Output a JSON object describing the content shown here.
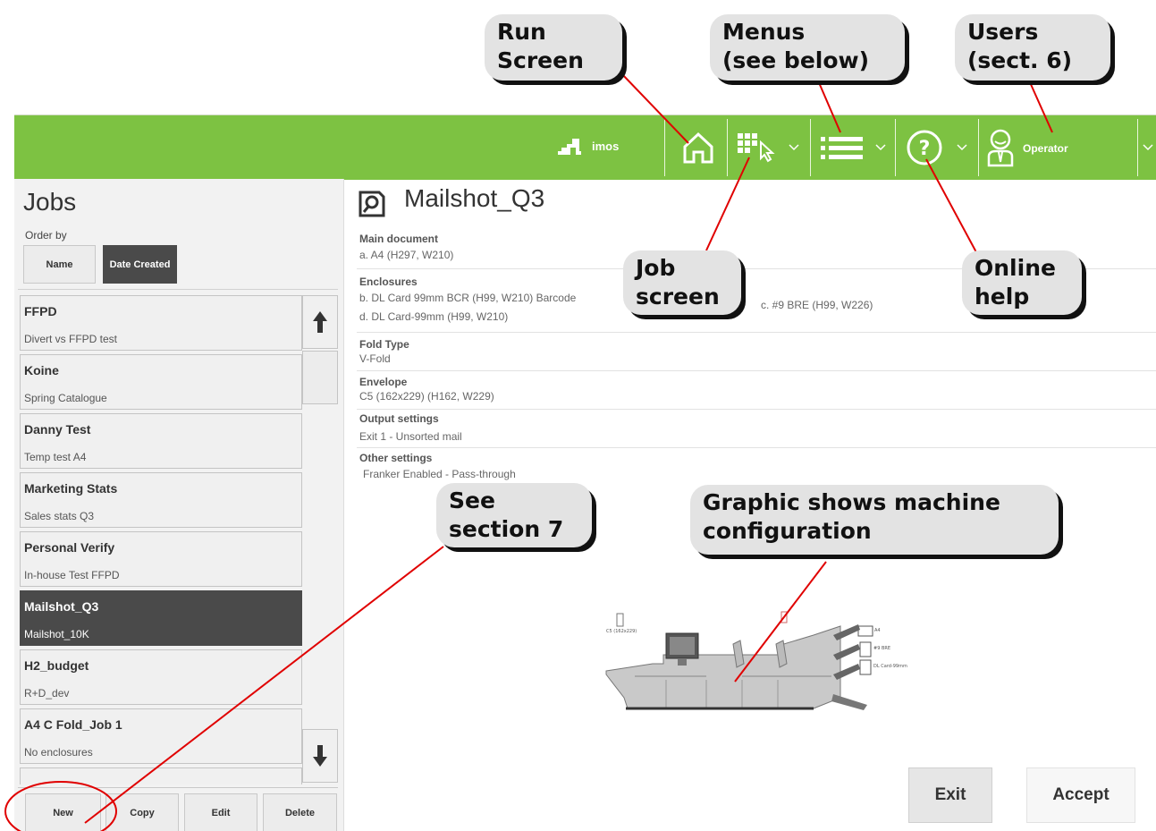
{
  "topbar": {
    "brand_name": "imos",
    "user_label": "Operator",
    "icons": [
      "franker-icon",
      "home-icon",
      "job-screen-icon",
      "menu-icon",
      "help-icon",
      "user-icon",
      "chevron-down-icon"
    ],
    "bar_color": "#7dc242"
  },
  "sidebar": {
    "title": "Jobs",
    "order_by_label": "Order by",
    "sort_buttons": [
      "Name",
      "Date Created"
    ],
    "active_sort": "Date Created",
    "jobs": [
      {
        "name": "FFPD",
        "subtitle": "Divert vs FFPD test"
      },
      {
        "name": "Koine",
        "subtitle": "Spring Catalogue"
      },
      {
        "name": "Danny Test",
        "subtitle": "Temp test A4"
      },
      {
        "name": "Marketing Stats",
        "subtitle": "Sales stats Q3"
      },
      {
        "name": "Personal Verify",
        "subtitle": "In-house Test FFPD"
      },
      {
        "name": "Mailshot_Q3",
        "subtitle": "Mailshot_10K"
      },
      {
        "name": "H2_budget",
        "subtitle": "R+D_dev"
      },
      {
        "name": "A4 C Fold_Job 1",
        "subtitle": "No enclosures"
      }
    ],
    "selected_job": "Mailshot_Q3",
    "bottom_buttons": [
      "New",
      "Copy",
      "Edit",
      "Delete"
    ]
  },
  "detail": {
    "title": "Mailshot_Q3",
    "main_document_label": "Main document",
    "main_document_value": "a. A4 (H297, W210)",
    "enclosures_label": "Enclosures",
    "enclosure_b": "b. DL Card 99mm BCR (H99, W210) Barcode",
    "enclosure_c": "c. #9 BRE (H99, W226)",
    "enclosure_d": "d. DL Card-99mm (H99, W210)",
    "fold_type_label": "Fold Type",
    "fold_type_value": "V-Fold",
    "envelope_label": "Envelope",
    "envelope_value": "C5 (162x229) (H162, W229)",
    "output_label": "Output settings",
    "output_value": "Exit 1 - Unsorted mail",
    "other_label": "Other settings",
    "other_value": "Franker Enabled - Pass-through"
  },
  "machine": {
    "label_envelope": "C5 (162x229)",
    "label_docs": [
      "A4",
      "#9 BRE",
      "DL Card-99mm"
    ]
  },
  "actions": {
    "exit_label": "Exit",
    "accept_label": "Accept"
  },
  "callouts": {
    "run_screen": [
      "Run",
      "Screen"
    ],
    "menus": [
      "Menus",
      "(see below)"
    ],
    "users": [
      "Users",
      "(sect. 6)"
    ],
    "job_screen": [
      "Job",
      "screen"
    ],
    "online_help": [
      "Online",
      "help"
    ],
    "see_section": [
      "See",
      "section 7"
    ],
    "graphic": [
      "Graphic shows machine",
      "configuration"
    ],
    "line_color": "#e00000"
  }
}
